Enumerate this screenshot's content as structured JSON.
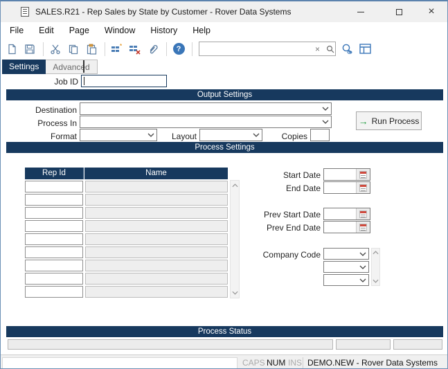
{
  "colors": {
    "navy_header": "#17395e",
    "accent_blue": "#3a76b8",
    "toolbar_icon_blue": "#5d7fa3",
    "run_arrow_green": "#1f9d3f",
    "calendar_red": "#cf4a3e"
  },
  "window": {
    "title": "SALES.R21 - Rep Sales by State by Customer - Rover Data Systems"
  },
  "menu": {
    "items": [
      "File",
      "Edit",
      "Page",
      "Window",
      "History",
      "Help"
    ]
  },
  "toolbar": {
    "search_value": "",
    "clear_glyph": "×"
  },
  "tabs": {
    "settings": "Settings",
    "advanced": "Advanced"
  },
  "form": {
    "job_id_label": "Job ID",
    "job_id_value": "",
    "output": {
      "header": "Output Settings",
      "destination_label": "Destination",
      "destination_value": "",
      "process_in_label": "Process In",
      "process_in_value": "",
      "format_label": "Format",
      "format_value": "",
      "layout_label": "Layout",
      "layout_value": "",
      "copies_label": "Copies",
      "copies_value": "",
      "run_arrow": "→",
      "run_button_label": "Run Process"
    },
    "process": {
      "header": "Process Settings",
      "grid": {
        "columns": [
          "Rep Id",
          "Name"
        ],
        "rows": [
          {
            "rep_id": "",
            "name": ""
          },
          {
            "rep_id": "",
            "name": ""
          },
          {
            "rep_id": "",
            "name": ""
          },
          {
            "rep_id": "",
            "name": ""
          },
          {
            "rep_id": "",
            "name": ""
          },
          {
            "rep_id": "",
            "name": ""
          },
          {
            "rep_id": "",
            "name": ""
          },
          {
            "rep_id": "",
            "name": ""
          },
          {
            "rep_id": "",
            "name": ""
          }
        ]
      },
      "dates": [
        {
          "label": "Start Date",
          "value": ""
        },
        {
          "label": "End Date",
          "value": ""
        },
        {
          "label": "Prev Start Date",
          "value": ""
        },
        {
          "label": "Prev End Date",
          "value": ""
        }
      ],
      "company_code": {
        "label": "Company Code",
        "values": [
          "",
          "",
          ""
        ]
      }
    },
    "status_section": {
      "header": "Process Status",
      "fields": [
        "",
        "",
        ""
      ]
    }
  },
  "status_bar": {
    "message": "",
    "caps": "CAPS",
    "num": "NUM",
    "ins": "INS",
    "connection": "DEMO.NEW - Rover Data Systems",
    "close_glyph": "×"
  }
}
